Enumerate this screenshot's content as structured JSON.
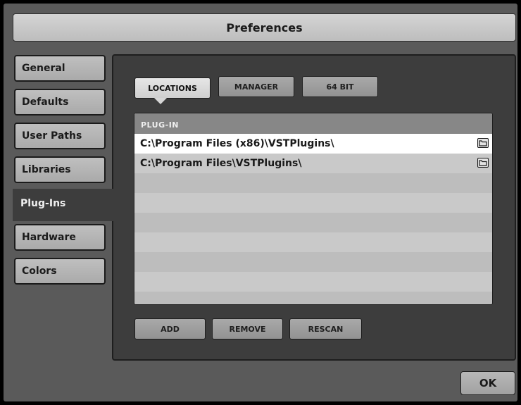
{
  "window": {
    "title": "Preferences"
  },
  "nav": {
    "items": [
      {
        "label": "General"
      },
      {
        "label": "Defaults"
      },
      {
        "label": "User Paths"
      },
      {
        "label": "Libraries"
      },
      {
        "label": "Plug-Ins"
      },
      {
        "label": "Hardware"
      },
      {
        "label": "Colors"
      }
    ],
    "active": "Plug-Ins"
  },
  "subtabs": {
    "items": [
      {
        "label": "LOCATIONS"
      },
      {
        "label": "MANAGER"
      },
      {
        "label": "64 BIT"
      }
    ],
    "active": "LOCATIONS"
  },
  "table": {
    "header": "PLUG-IN",
    "rows": [
      {
        "path": "C:\\Program Files (x86)\\VSTPlugins\\",
        "icon": "folder-icon"
      },
      {
        "path": "C:\\Program Files\\VSTPlugins\\",
        "icon": "folder-icon"
      }
    ],
    "selected_row": 0
  },
  "actions": {
    "add": "ADD",
    "remove": "REMOVE",
    "rescan": "RESCAN"
  },
  "footer": {
    "ok": "OK"
  },
  "colors": {
    "window_bg": "#5a5a5a",
    "panel_bg": "#3d3d3d",
    "selected_row": "#ffffff"
  }
}
